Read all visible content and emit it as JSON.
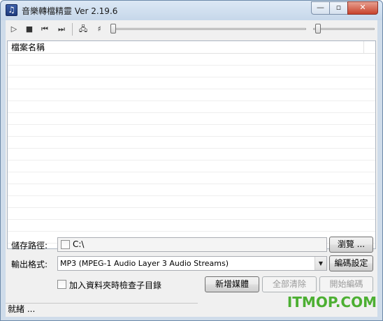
{
  "window": {
    "title": "音樂轉檔精靈 Ver 2.19.6",
    "icon": "music-note-icon",
    "min_glyph": "—",
    "max_glyph": "▫",
    "close_glyph": "✕"
  },
  "toolbar": {
    "play_glyph": "▷",
    "stop_glyph": "■",
    "prev_glyph": "⏮",
    "next_glyph": "⏭",
    "settings_glyph": "🖧",
    "mixer_glyph": "♯"
  },
  "list": {
    "column_header": "檔案名稱",
    "rows": []
  },
  "form": {
    "save_path_label": "儲存路徑:",
    "save_path_value": "C:\\",
    "browse_button": "瀏覽 ...",
    "output_format_label": "輸出格式:",
    "output_format_value": "MP3 (MPEG-1 Audio Layer 3 Audio Streams)",
    "encode_settings_button": "編碼設定",
    "include_subfolders_label": "加入資料夾時檢查子目錄",
    "add_media_button": "新增媒體",
    "clear_all_button": "全部清除",
    "start_encode_button": "開始編碼"
  },
  "status": {
    "text": "就緒 ..."
  },
  "watermark": "ITMOP.COM"
}
